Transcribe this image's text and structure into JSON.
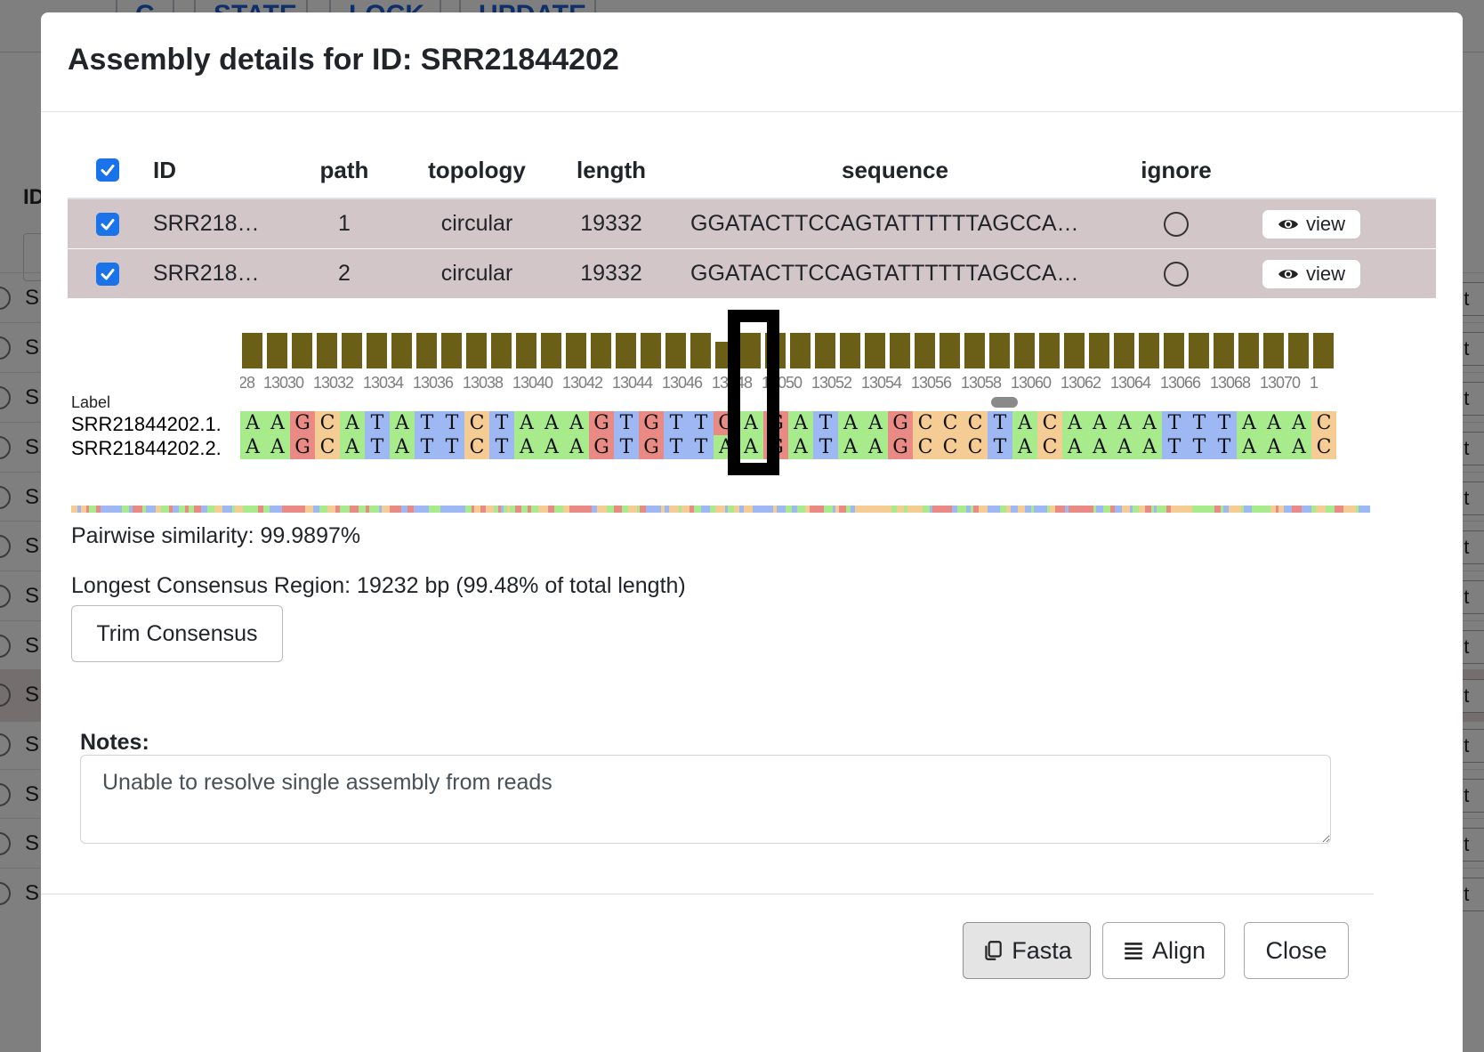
{
  "background": {
    "top_buttons": [
      "C",
      "STATE",
      "LOCK",
      "UPDATE"
    ],
    "id_header": "ID",
    "row_letter": "S",
    "row_button_label": "ut"
  },
  "modal": {
    "title": "Assembly details for ID: SRR21844202",
    "table": {
      "columns": [
        "ID",
        "path",
        "topology",
        "length",
        "sequence",
        "ignore"
      ],
      "rows": [
        {
          "id": "SRR218…",
          "path": "1",
          "topology": "circular",
          "length": "19332",
          "sequence": "GGATACTTCCAGTATTTTTTAGCCA…",
          "view_label": "view"
        },
        {
          "id": "SRR218…",
          "path": "2",
          "topology": "circular",
          "length": "19332",
          "sequence": "GGATACTTCCAGTATTTTTTAGCCA…",
          "view_label": "view"
        }
      ]
    },
    "alignment": {
      "label_header": "Label",
      "ticks": [
        "28",
        "13030",
        "13032",
        "13034",
        "13036",
        "13038",
        "13040",
        "13042",
        "13044",
        "13046",
        "13048",
        "13050",
        "13052",
        "13054",
        "13056",
        "13058",
        "13060",
        "13062",
        "13064",
        "13066",
        "13068",
        "13070",
        "1"
      ],
      "sequences": [
        {
          "name": "SRR21844202.1.",
          "bases": "AAGCATATTCTAAAGTGTTGAGATAAGCCCTACAAAATTTAAAC"
        },
        {
          "name": "SRR21844202.2.",
          "bases": "AAGCATATTCTAAAGTGTTAAGATAAGCCCTACAAAATTTAAAC"
        }
      ],
      "selected_column_index": 19,
      "coverage_color": "#6b5e16",
      "base_colors": {
        "A": "#a7eb8c",
        "C": "#f5cc93",
        "G": "#ea8a84",
        "T": "#9db8f2"
      }
    },
    "similarity": "Pairwise similarity: 99.9897%",
    "consensus": "Longest Consensus Region: 19232 bp (99.48% of total length)",
    "trim_button": "Trim Consensus",
    "notes_label": "Notes:",
    "notes_value": "Unable to resolve single assembly from reads",
    "footer": {
      "fasta": "Fasta",
      "align": "Align",
      "close": "Close"
    }
  }
}
